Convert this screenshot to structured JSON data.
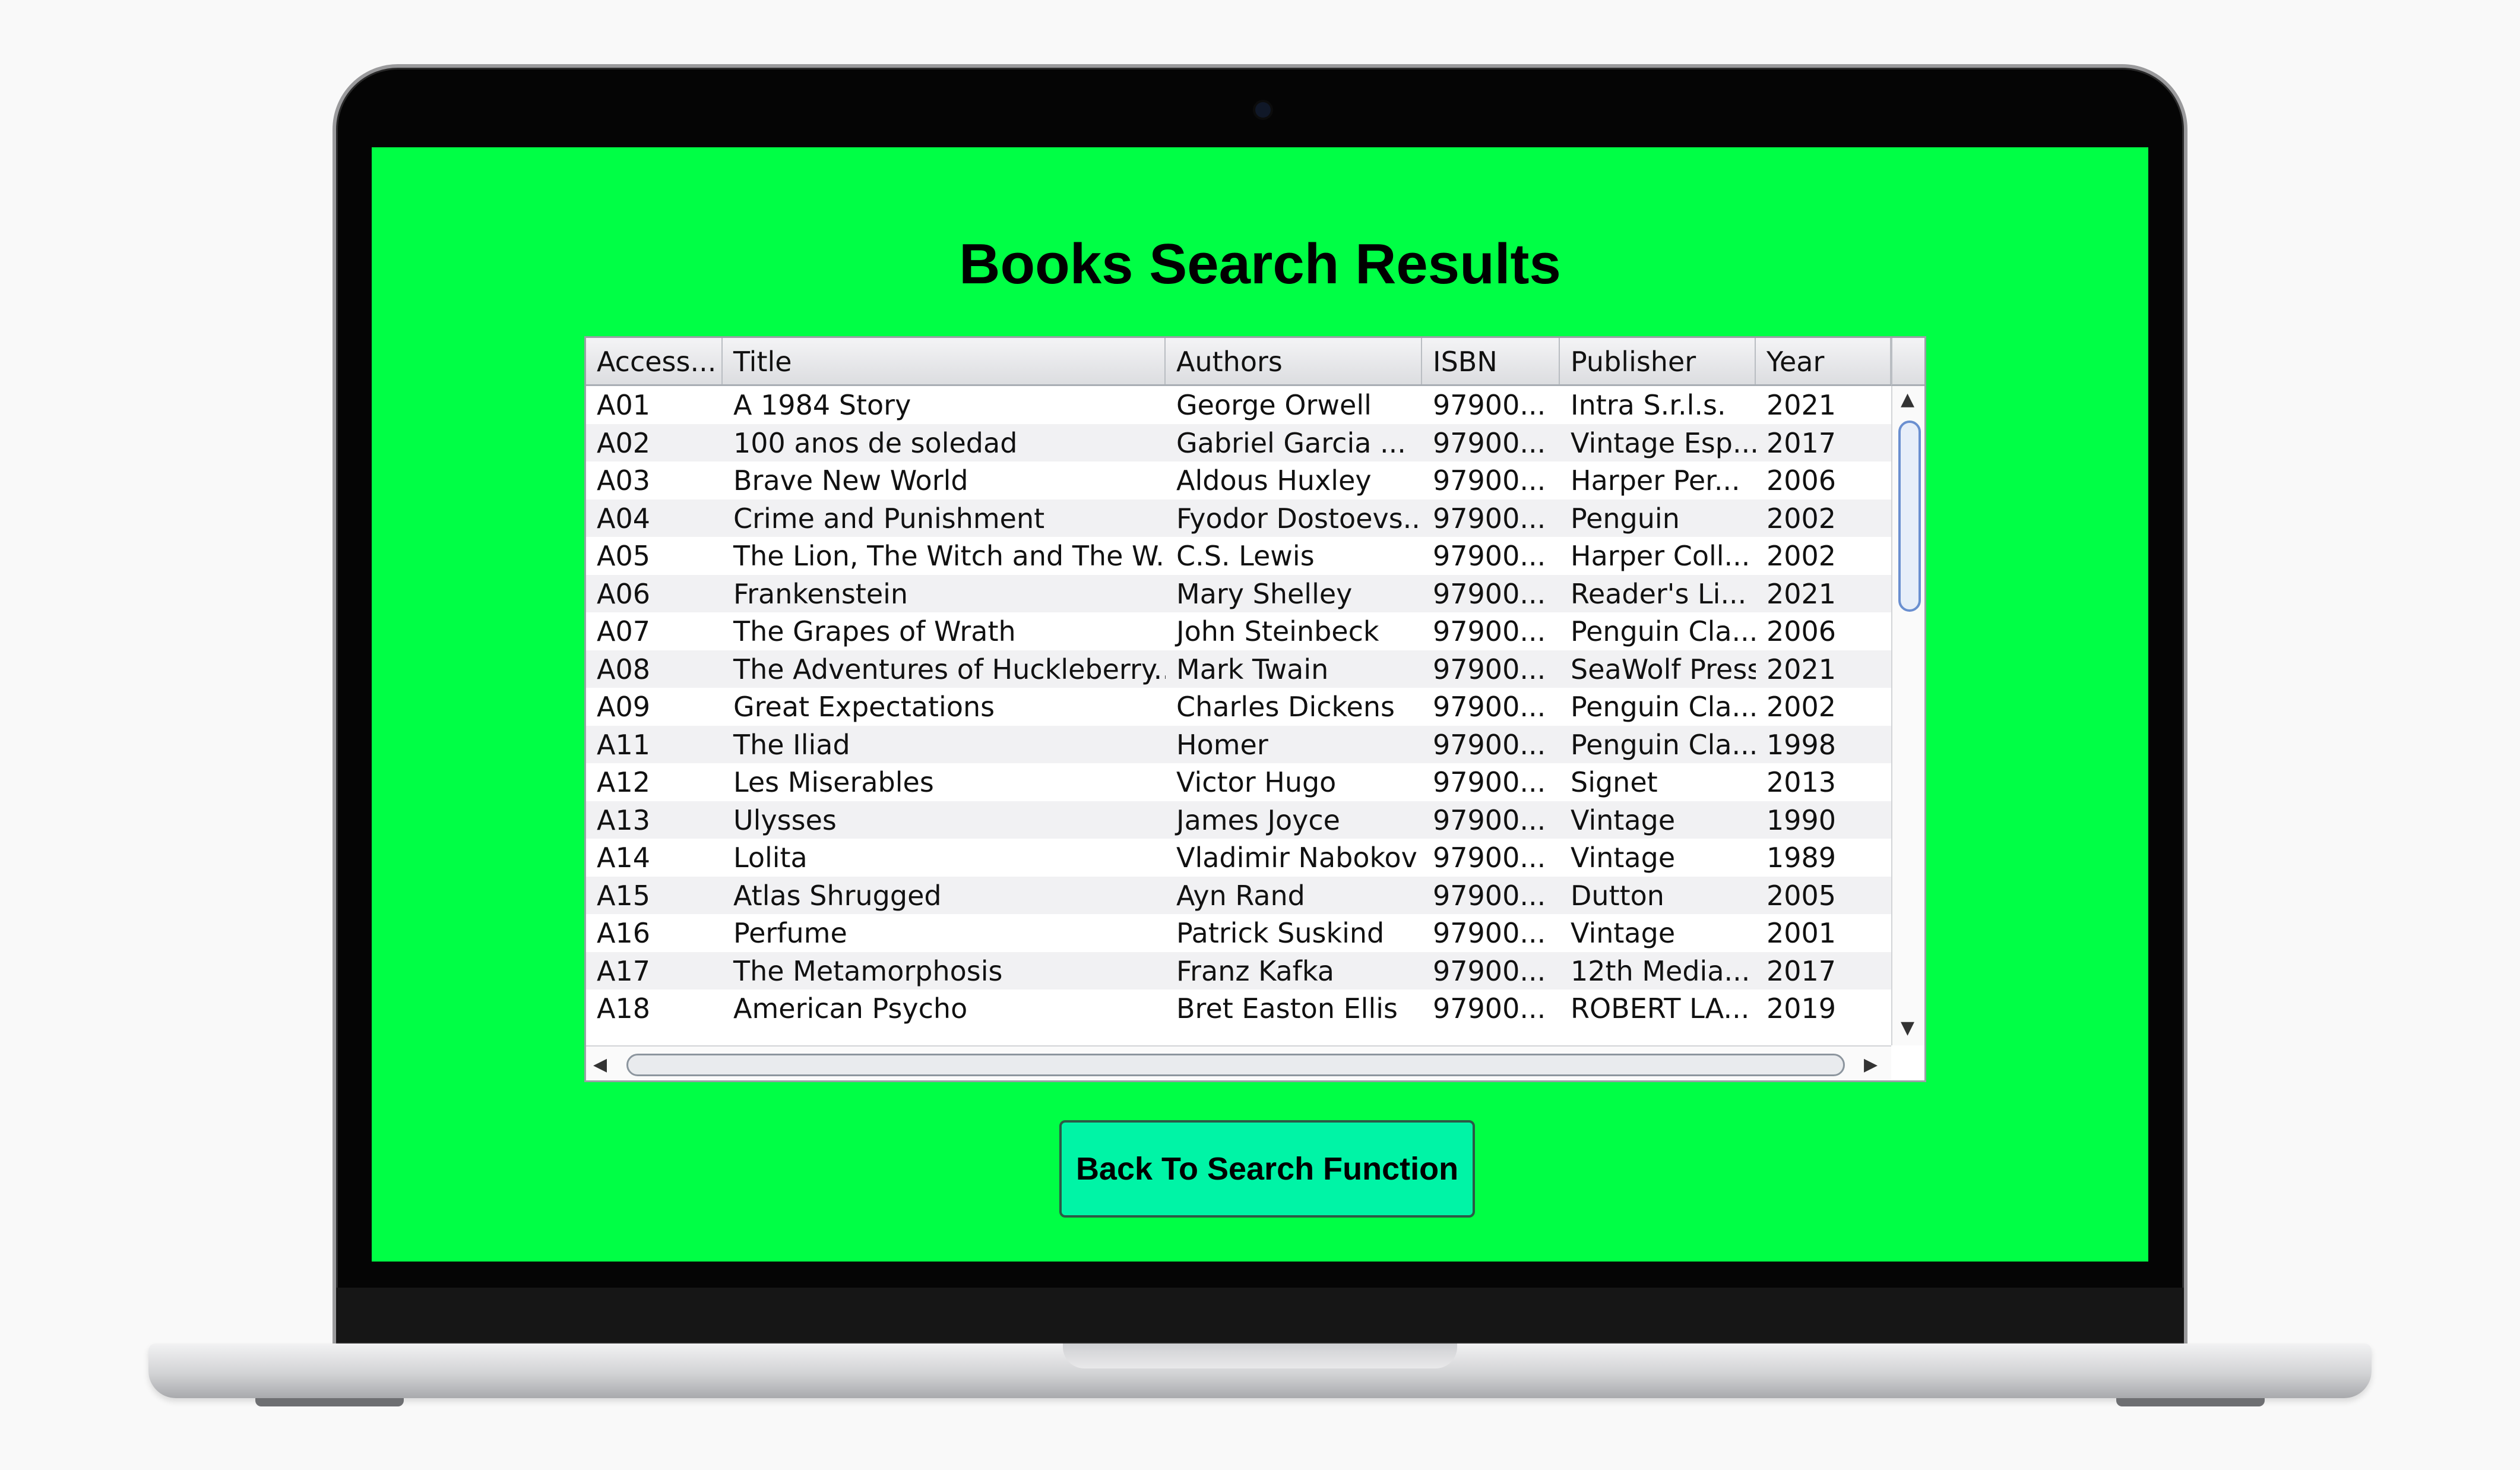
{
  "window": {
    "title": "Books Search Results"
  },
  "table": {
    "columns": [
      "Access...",
      "Title",
      "Authors",
      "ISBN",
      "Publisher",
      "Year"
    ],
    "rows": [
      [
        "A01",
        "A 1984 Story",
        "George Orwell",
        "97900...",
        "Intra S.r.l.s.",
        "2021"
      ],
      [
        "A02",
        "100 anos de soledad",
        "Gabriel Garcia ...",
        "97900...",
        "Vintage Esp...",
        "2017"
      ],
      [
        "A03",
        "Brave New World",
        "Aldous Huxley",
        "97900...",
        "Harper Per...",
        "2006"
      ],
      [
        "A04",
        "Crime and Punishment",
        "Fyodor Dostoevs...",
        "97900...",
        "Penguin",
        "2002"
      ],
      [
        "A05",
        "The Lion, The Witch and The W...",
        "C.S. Lewis",
        "97900...",
        "Harper Coll...",
        "2002"
      ],
      [
        "A06",
        "Frankenstein",
        "Mary Shelley",
        "97900...",
        "Reader's Li...",
        "2021"
      ],
      [
        "A07",
        "The Grapes of Wrath",
        "John Steinbeck",
        "97900...",
        "Penguin Cla...",
        "2006"
      ],
      [
        "A08",
        "The Adventures of Huckleberry...",
        "Mark Twain",
        "97900...",
        "SeaWolf Press",
        "2021"
      ],
      [
        "A09",
        "Great Expectations",
        "Charles Dickens",
        "97900...",
        "Penguin Cla...",
        "2002"
      ],
      [
        "A11",
        "The Iliad",
        "Homer",
        "97900...",
        "Penguin Cla...",
        "1998"
      ],
      [
        "A12",
        "Les Miserables",
        "Victor Hugo",
        "97900...",
        "Signet",
        "2013"
      ],
      [
        "A13",
        "Ulysses",
        "James Joyce",
        "97900...",
        "Vintage",
        "1990"
      ],
      [
        "A14",
        "Lolita",
        "Vladimir Nabokov",
        "97900...",
        "Vintage",
        "1989"
      ],
      [
        "A15",
        "Atlas Shrugged",
        "Ayn Rand",
        "97900...",
        "Dutton",
        "2005"
      ],
      [
        "A16",
        "Perfume",
        "Patrick Suskind",
        "97900...",
        "Vintage",
        "2001"
      ],
      [
        "A17",
        "The Metamorphosis",
        "Franz Kafka",
        "97900...",
        "12th Media...",
        "2017"
      ],
      [
        "A18",
        "American Psycho",
        "Bret Easton Ellis",
        "97900...",
        "ROBERT LA...",
        "2019"
      ]
    ]
  },
  "scrollbar": {
    "up_arrow": "▲",
    "down_arrow": "▼",
    "left_arrow": "◀",
    "right_arrow": "▶"
  },
  "button": {
    "back_label": "Back To Search Function"
  },
  "colors": {
    "screen_background": "#00ff45",
    "button_background": "#00f4a6"
  }
}
